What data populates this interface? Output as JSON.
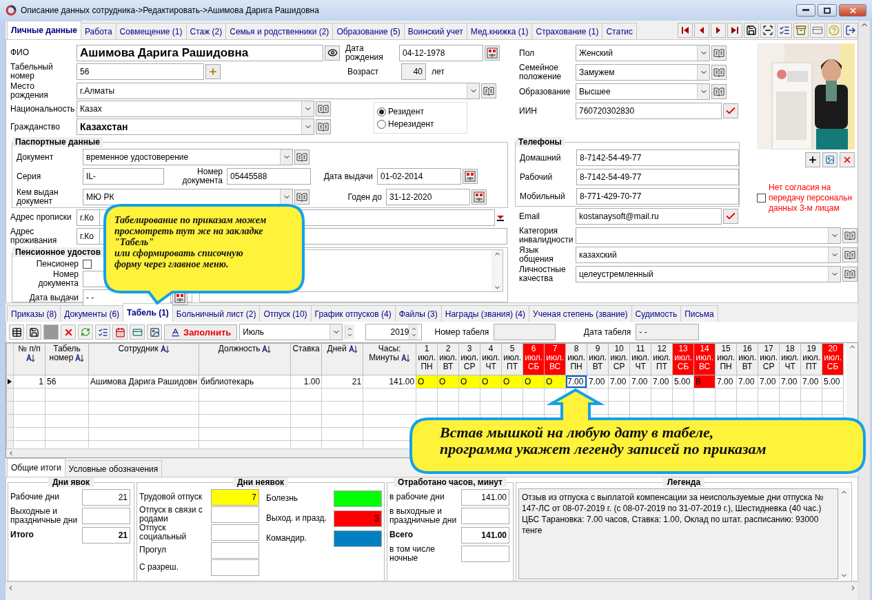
{
  "window": {
    "title": "Описание данных сотрудника->Редактировать->Ашимова Дарига Рашидовна"
  },
  "tabs": [
    {
      "label": "Личные данные",
      "selected": true
    },
    {
      "label": "Работа",
      "selected": false
    },
    {
      "label": "Совмещение (1)",
      "selected": false
    },
    {
      "label": "Стаж (2)",
      "selected": false
    },
    {
      "label": "Семья и родственники (2)",
      "selected": false
    },
    {
      "label": "Образование (5)",
      "selected": false
    },
    {
      "label": "Воинский учет",
      "selected": false
    },
    {
      "label": "Мед.книжка (1)",
      "selected": false
    },
    {
      "label": "Страхование (1)",
      "selected": false
    },
    {
      "label": "Статис",
      "selected": false
    }
  ],
  "personal": {
    "fio": {
      "label": "ФИО",
      "value": "Ашимова Дарига Рашидовна"
    },
    "tab_number": {
      "label": "Табельный номер",
      "value": "56"
    },
    "birth_date": {
      "label": "Дата рождения",
      "value": "04-12-1978"
    },
    "age": {
      "label": "Возраст",
      "value": "40",
      "unit": "лет"
    },
    "birth_place": {
      "label": "Место рождения",
      "value": "г.Алматы"
    },
    "nationality": {
      "label": "Национальность",
      "value": "Казах"
    },
    "citizenship": {
      "label": "Гражданство",
      "value": "Казахстан"
    },
    "residency": [
      {
        "label": "Резидент",
        "selected": true
      },
      {
        "label": "Нерезидент",
        "selected": false
      }
    ]
  },
  "passport": {
    "title": "Паспортные данные",
    "document": {
      "label": "Документ",
      "value": "временное удостоверение"
    },
    "series": {
      "label": "Серия",
      "value": "IL-"
    },
    "number": {
      "label": "Номер документа",
      "value": "05445588"
    },
    "issue_date": {
      "label": "Дата выдачи",
      "value": "01-02-2014"
    },
    "issued_by": {
      "label": "Кем выдан документ",
      "value": "МЮ РК"
    },
    "valid_until": {
      "label": "Годен до",
      "value": "31-12-2020"
    }
  },
  "addresses": [
    {
      "label": "Адрес прописки",
      "value": "г.Ко"
    },
    {
      "label": "Адрес проживания",
      "value": "г.Ко"
    }
  ],
  "pension": {
    "title": "Пенсионное удостов",
    "pensioner": {
      "label": "Пенсионер",
      "checked": false
    },
    "number": {
      "label": "Номер документа"
    },
    "issue_date": {
      "label": "Дата выдачи",
      "value": "- -"
    }
  },
  "details": [
    {
      "label": "Пол",
      "value": "Женский"
    },
    {
      "label": "Семейное положение",
      "value": "Замужем"
    },
    {
      "label": "Образование",
      "value": "Высшее"
    }
  ],
  "iin": {
    "label": "ИИН",
    "value": "760720302830"
  },
  "phones": {
    "title": "Телефоны",
    "items": [
      {
        "label": "Домашний",
        "value": "8-7142-54-49-77"
      },
      {
        "label": "Рабочий",
        "value": "8-7142-54-49-77"
      },
      {
        "label": "Мобильный",
        "value": "8-771-429-70-77"
      }
    ]
  },
  "email": {
    "label": "Email",
    "value": "kostanaysoft@mail.ru"
  },
  "extra": [
    {
      "label": "Категория инвалидности"
    },
    {
      "label": "Язык общения",
      "value": "казахский"
    },
    {
      "label": "Личностные качества",
      "value": "целеустремленный"
    }
  ],
  "consent": {
    "lines": [
      "Нет согласия на",
      "передачу персональн",
      "данных 3-м лицам"
    ],
    "checked": false
  },
  "sub_tabs": [
    {
      "label": "Приказы (8)",
      "selected": false
    },
    {
      "label": "Документы (6)",
      "selected": false
    },
    {
      "label": "Табель (1)",
      "selected": true
    },
    {
      "label": "Больничный лист (2)",
      "selected": false
    },
    {
      "label": "Отпуск (10)",
      "selected": false
    },
    {
      "label": "График отпусков (4)",
      "selected": false
    },
    {
      "label": "Файлы (3)",
      "selected": false
    },
    {
      "label": "Награды (звания) (4)",
      "selected": false
    },
    {
      "label": "Ученая степень (звание)",
      "selected": false
    },
    {
      "label": "Судимость",
      "selected": false
    },
    {
      "label": "Письма",
      "selected": false
    }
  ],
  "sheet_toolbar": {
    "fill_button": "Заполнить",
    "month": "Июль",
    "year": "2019",
    "number_label": "Номер табеля",
    "date_label": "Дата табеля",
    "date": "- -"
  },
  "grid": {
    "columns": [
      {
        "label": "№ п/п",
        "sortable": true
      },
      {
        "label": "Табель номер",
        "sortable": true
      },
      {
        "label": "Сотрудник",
        "sortable": true
      },
      {
        "label": "Должность",
        "sortable": true
      },
      {
        "label": "Ставка",
        "sortable": false
      },
      {
        "label": "Дней",
        "sortable": true
      },
      {
        "label": "Часы: Минуты",
        "sortable": true
      }
    ],
    "days": [
      {
        "day": "1",
        "month": "июл.",
        "weekday": "ПН",
        "weekend": false
      },
      {
        "day": "2",
        "month": "июл.",
        "weekday": "ВТ",
        "weekend": false
      },
      {
        "day": "3",
        "month": "июл.",
        "weekday": "СР",
        "weekend": false
      },
      {
        "day": "4",
        "month": "июл.",
        "weekday": "ЧТ",
        "weekend": false
      },
      {
        "day": "5",
        "month": "июл.",
        "weekday": "ПТ",
        "weekend": false
      },
      {
        "day": "6",
        "month": "июл.",
        "weekday": "СБ",
        "weekend": true
      },
      {
        "day": "7",
        "month": "июл.",
        "weekday": "ВС",
        "weekend": true
      },
      {
        "day": "8",
        "month": "июл.",
        "weekday": "ПН",
        "weekend": false
      },
      {
        "day": "9",
        "month": "июл.",
        "weekday": "ВТ",
        "weekend": false
      },
      {
        "day": "10",
        "month": "июл.",
        "weekday": "СР",
        "weekend": false
      },
      {
        "day": "11",
        "month": "июл.",
        "weekday": "ЧТ",
        "weekend": false
      },
      {
        "day": "12",
        "month": "июл.",
        "weekday": "ПТ",
        "weekend": false
      },
      {
        "day": "13",
        "month": "июл.",
        "weekday": "СБ",
        "weekend": true
      },
      {
        "day": "14",
        "month": "июл.",
        "weekday": "ВС",
        "weekend": true
      },
      {
        "day": "15",
        "month": "июл.",
        "weekday": "ПН",
        "weekend": false
      },
      {
        "day": "16",
        "month": "июл.",
        "weekday": "ВТ",
        "weekend": false
      },
      {
        "day": "17",
        "month": "июл.",
        "weekday": "СР",
        "weekend": false
      },
      {
        "day": "18",
        "month": "июл.",
        "weekday": "ЧТ",
        "weekend": false
      },
      {
        "day": "19",
        "month": "июл.",
        "weekday": "ПТ",
        "weekend": false
      },
      {
        "day": "20",
        "month": "июл.",
        "weekday": "СБ",
        "weekend": true
      }
    ],
    "rows": [
      {
        "cells": [
          "1",
          "56",
          "Ашимова Дарига Рашидовн",
          "библиотекарь",
          "1.00",
          "21",
          "141.00"
        ],
        "days": [
          {
            "value": "О",
            "kind": "vacation",
            "selected": false
          },
          {
            "value": "О",
            "kind": "vacation",
            "selected": false
          },
          {
            "value": "О",
            "kind": "vacation",
            "selected": false
          },
          {
            "value": "О",
            "kind": "vacation",
            "selected": false
          },
          {
            "value": "О",
            "kind": "vacation",
            "selected": false
          },
          {
            "value": "О",
            "kind": "vacation",
            "selected": false
          },
          {
            "value": "О",
            "kind": "vacation",
            "selected": false
          },
          {
            "value": "7.00",
            "kind": "hours",
            "selected": true
          },
          {
            "value": "7.00",
            "kind": "hours",
            "selected": false
          },
          {
            "value": "7.00",
            "kind": "hours",
            "selected": false
          },
          {
            "value": "7.00",
            "kind": "hours",
            "selected": false
          },
          {
            "value": "7.00",
            "kind": "hours",
            "selected": false
          },
          {
            "value": "5.00",
            "kind": "hours",
            "selected": false
          },
          {
            "value": "В",
            "kind": "day_off",
            "selected": false
          },
          {
            "value": "7.00",
            "kind": "hours",
            "selected": false
          },
          {
            "value": "7.00",
            "kind": "hours",
            "selected": false
          },
          {
            "value": "7.00",
            "kind": "hours",
            "selected": false
          },
          {
            "value": "7.00",
            "kind": "hours",
            "selected": false
          },
          {
            "value": "7.00",
            "kind": "hours",
            "selected": false
          },
          {
            "value": "5.00",
            "kind": "hours",
            "selected": false
          }
        ]
      }
    ]
  },
  "bottom_tabs": [
    {
      "label": "Общие итоги",
      "selected": true
    },
    {
      "label": "Условные обозначения",
      "selected": false
    }
  ],
  "attendance": {
    "title": "Дни явок",
    "items": [
      {
        "label": "Рабочие дни",
        "value": "21",
        "kind": "plain"
      },
      {
        "label": "Выходные и праздничные дни",
        "kind": "plain"
      },
      {
        "label": "Итого",
        "value": "21",
        "kind": "total"
      }
    ]
  },
  "absence": {
    "title": "Дни неявок",
    "items": [
      {
        "label": "Трудовой отпуск",
        "value": "7",
        "color": "#ffff00"
      },
      {
        "label": "Отпуск в связи с родами"
      },
      {
        "label": "Отпуск социальный"
      },
      {
        "label": "Прогул"
      },
      {
        "label": "С разреш."
      }
    ],
    "legend": [
      {
        "label": "Болезнь",
        "color": "#00ff00"
      },
      {
        "label": "Выход. и празд.",
        "value": "3",
        "color": "#ff0000"
      },
      {
        "label": "Командир.",
        "color": "#0080c0"
      }
    ]
  },
  "hours": {
    "title": "Отработано часов, минут",
    "items": [
      {
        "label": "в рабочие дни",
        "value": "141.00",
        "kind": "plain"
      },
      {
        "label": "в выходные и праздничные дни",
        "kind": "plain"
      },
      {
        "label": "Всего",
        "value": "141.00",
        "kind": "total"
      },
      {
        "label": "в том числе ночные",
        "kind": "plain"
      }
    ]
  },
  "legend": {
    "title": "Легенда",
    "text": "Отзыв из отпуска с выплатой компенсации за неиспользуемые дни отпуска № 147-ЛС от 08-07-2019 г. (с 08-07-2019 по 31-07-2019 г.), Шестидневка (40 час.) ЦБС Тарановка: 7.00 часов, Ставка:  1.00, Оклад по штат. расписанию: 93000 тенге"
  },
  "callouts": [
    {
      "lines": [
        "Табелирование по приказам можем",
        "просмотреть тут же на закладке",
        "\"Табель\"",
        "или сформировать списочную",
        "форму через главное меню."
      ]
    },
    {
      "lines": [
        "Встав мышкой на любую дату в табеле,",
        "программа укажет легенду записей по приказам"
      ]
    }
  ]
}
